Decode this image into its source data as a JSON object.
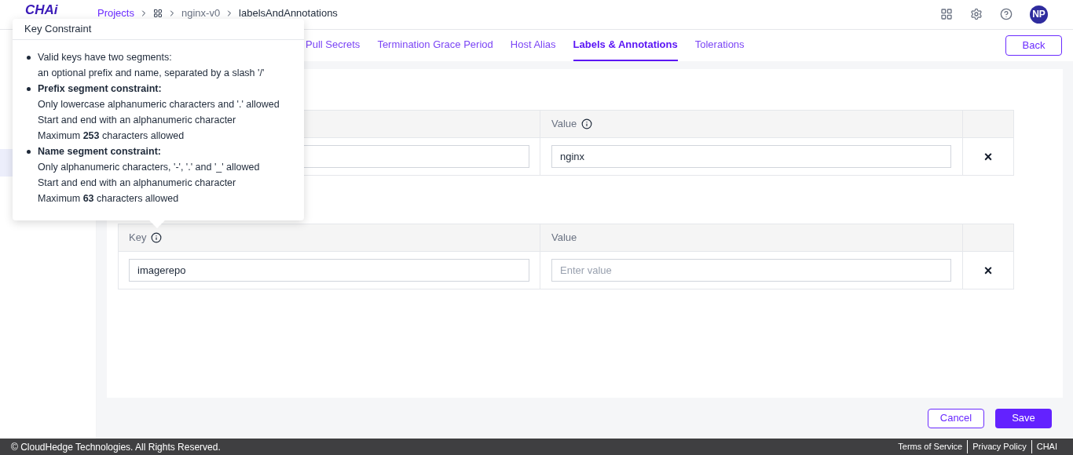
{
  "header": {
    "logo": "CHAi",
    "breadcrumb": [
      {
        "label": "Projects",
        "kind": "link"
      },
      {
        "kind": "icon"
      },
      {
        "label": "nginx-v0",
        "kind": "muted"
      },
      {
        "label": "labelsAndAnnotations",
        "kind": "current"
      }
    ],
    "avatar": "NP"
  },
  "sidebar": {
    "items": [
      {
        "selected": true
      }
    ]
  },
  "tabs": [
    {
      "label": "Pull Secrets",
      "selected": false
    },
    {
      "label": "Termination Grace Period",
      "selected": false
    },
    {
      "label": "Host Alias",
      "selected": false
    },
    {
      "label": "Labels & Annotations",
      "selected": true
    },
    {
      "label": "Tolerations",
      "selected": false
    }
  ],
  "back_button": "Back",
  "tables": [
    {
      "value_header": {
        "label": "Value",
        "info": true
      },
      "rows": [
        {
          "value": "nginx",
          "remove": "×"
        }
      ]
    },
    {
      "key_header": {
        "label": "Key",
        "info": true
      },
      "value_header": {
        "label": "Value",
        "info": false
      },
      "rows": [
        {
          "key": "imagerepo",
          "value_placeholder": "Enter value",
          "remove": "×"
        }
      ]
    }
  ],
  "tooltip": {
    "title": "Key Constraint",
    "items": [
      {
        "heading": "Valid keys have two segments:",
        "bold": false,
        "lines": [
          "an optional prefix and name, separated by a slash '/'"
        ]
      },
      {
        "heading": "Prefix segment constraint:",
        "bold": true,
        "lines": [
          "Only lowercase alphanumeric characters and '.' allowed",
          "Start and end with an alphanumeric character",
          "Maximum **253** characters allowed"
        ]
      },
      {
        "heading": "Name segment constraint:",
        "bold": true,
        "lines": [
          "Only alphanumeric characters, '-', '.' and '_' allowed",
          "Start and end with an alphanumeric character",
          "Maximum **63** characters allowed"
        ]
      }
    ]
  },
  "actions": {
    "cancel": "Cancel",
    "save": "Save"
  },
  "footer": {
    "copyright": "© CloudHedge Technologies. All Rights Reserved.",
    "links": [
      "Terms of Service",
      "Privacy Policy",
      "CHAI"
    ]
  }
}
